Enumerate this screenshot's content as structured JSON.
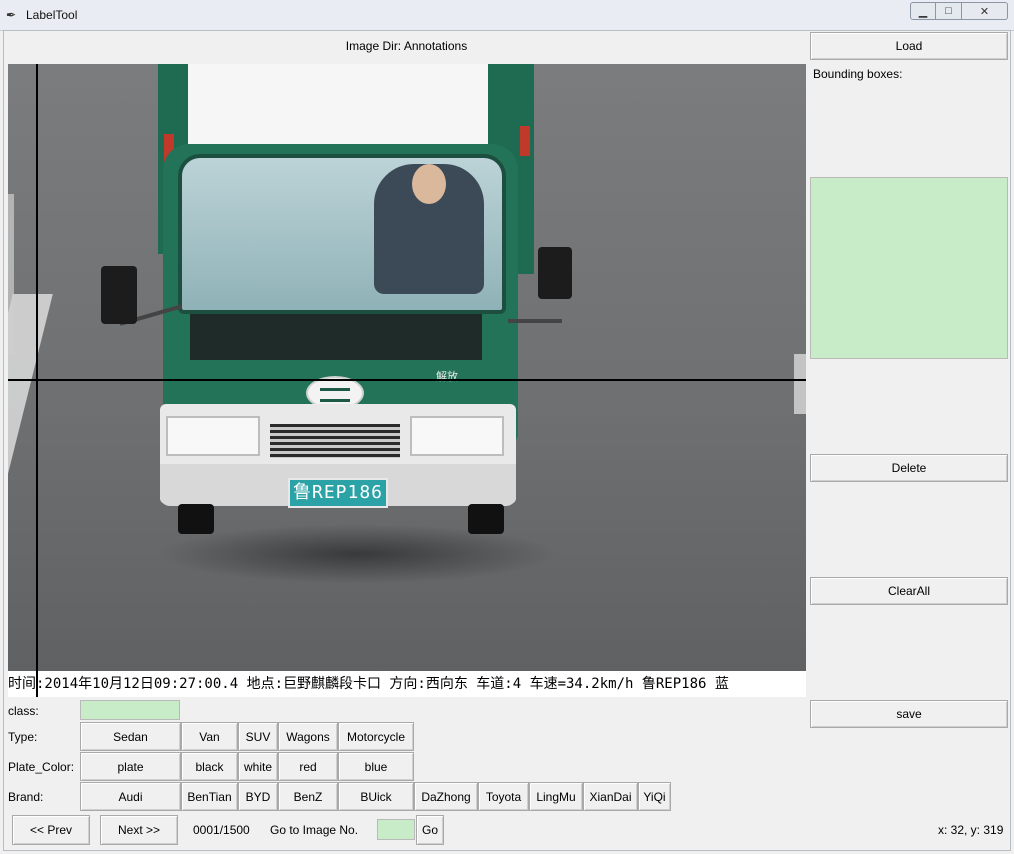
{
  "window": {
    "title": "LabelTool",
    "min_glyph": "▁",
    "max_glyph": "□",
    "close_glyph": "✕"
  },
  "header": {
    "image_dir": "Image Dir: Annotations"
  },
  "right_panel": {
    "load_label": "Load",
    "bounding_boxes_label": "Bounding boxes:",
    "delete_label": "Delete",
    "clearall_label": "ClearAll",
    "save_label": "save"
  },
  "image": {
    "plate_text": "鲁REP186",
    "cab_text": "解放",
    "caption": "时间:2014年10月12日09:27:00.4 地点:巨野麒麟段卡口 方向:西向东 车道:4 车速=34.2km/h 鲁REP186 蓝"
  },
  "form": {
    "class_label": "class:",
    "class_value": "",
    "type_label": "Type:",
    "types": [
      "Sedan",
      "Van",
      "SUV",
      "Wagons",
      "Motorcycle"
    ],
    "plate_color_label": "Plate_Color:",
    "plate_colors": [
      "plate",
      "black",
      "white",
      "red",
      "blue"
    ],
    "brand_label": "Brand:",
    "brands": [
      "Audi",
      "BenTian",
      "BYD",
      "BenZ",
      "BUick",
      "DaZhong",
      "Toyota",
      "LingMu",
      "XianDai",
      "YiQi"
    ]
  },
  "nav": {
    "prev_label": "<< Prev",
    "next_label": "Next >>",
    "progress": "0001/1500",
    "goto_label": "Go to Image No.",
    "goto_value": "",
    "go_label": "Go",
    "coords": "x: 32, y: 319"
  },
  "colors": {
    "entry_bg": "#c8ebc8",
    "truck_green": "#237359",
    "plate_blue": "#2aa2a6"
  }
}
